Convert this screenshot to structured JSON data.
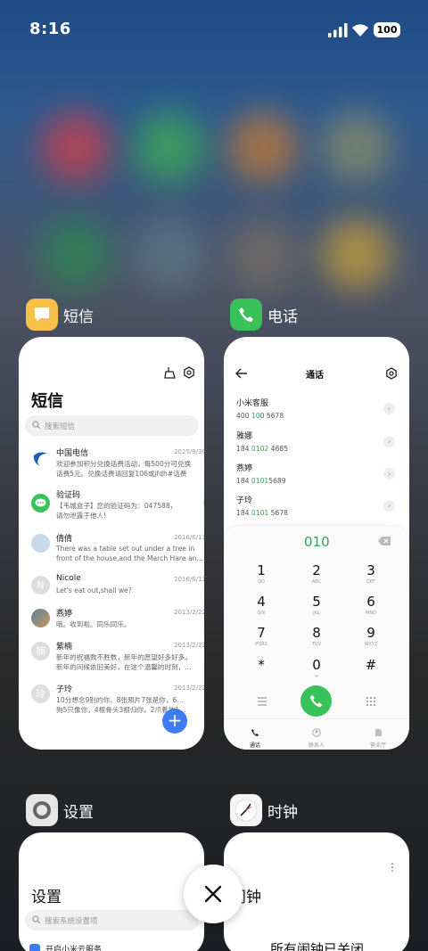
{
  "status_bar": {
    "time": "8:16",
    "battery": "100"
  },
  "apps": {
    "sms": {
      "name": "短信",
      "title": "短信",
      "search_placeholder": "搜索短信",
      "messages": [
        {
          "name": "中国电信",
          "date": "2025/9/30",
          "line1": "欢迎参加积分兑换话费活动，每500分可兑换",
          "line2": "话费5元。兑换话费请回复106或jfdh#话费"
        },
        {
          "name": "验证码",
          "date": "",
          "line1": "【韦城盒子】您的验证码为：047588，",
          "line2": "请勿泄露于他人!"
        },
        {
          "name": "倩倩",
          "date": "2016/6/13",
          "line1": "There was a table set out under a tree in",
          "line2": "front of the house,and the March Hare an..."
        },
        {
          "name": "Nicole",
          "date": "2016/6/13",
          "line1": "Let's eat out,shall we?",
          "line2": ""
        },
        {
          "name": "燕婷",
          "date": "2013/2/22",
          "line1": "哦。收到啦。同乐同乐。",
          "line2": ""
        },
        {
          "name": "紫楠",
          "date": "2013/2/22",
          "line1": "新年的祝福数不胜数，新年的愿望好多好多，",
          "line2": "新年的问候依旧美好，在这个温馨的时刻，..."
        },
        {
          "name": "子玲",
          "date": "2013/2/22",
          "line1": "10分想念9别的你，8张照片7张是你，6只小",
          "line2": "狗5只像你，4根骨头3根归你，2爪着地1定..."
        }
      ],
      "avatar_letters": {
        "nicole": "N",
        "zinan": "楠",
        "ziling": "玲"
      }
    },
    "phone": {
      "name": "电话",
      "title": "通话",
      "contacts": [
        {
          "name": "小米客服",
          "pre": "400 ",
          "hl": "10",
          "post": "0 5678"
        },
        {
          "name": "雅娜",
          "pre": "184 ",
          "hl": "0102",
          "post": " 4685"
        },
        {
          "name": "燕婷",
          "pre": "184 ",
          "hl": "0101",
          "post": "5689"
        },
        {
          "name": "子玲",
          "pre": "184 ",
          "hl": "0101",
          "post": " 5678"
        }
      ],
      "dial_input": "010",
      "keypad": [
        {
          "d": "1",
          "s": "QO"
        },
        {
          "d": "2",
          "s": "ABC"
        },
        {
          "d": "3",
          "s": "DEF"
        },
        {
          "d": "4",
          "s": "GHI"
        },
        {
          "d": "5",
          "s": "JKL"
        },
        {
          "d": "6",
          "s": "MNO"
        },
        {
          "d": "7",
          "s": "PQRS"
        },
        {
          "d": "8",
          "s": "TUV"
        },
        {
          "d": "9",
          "s": "WXYZ"
        },
        {
          "d": "*",
          "s": ""
        },
        {
          "d": "0",
          "s": "+"
        },
        {
          "d": "#",
          "s": ""
        }
      ],
      "tabs": [
        "通话",
        "联系人",
        "营业厅"
      ]
    },
    "settings": {
      "name": "设置",
      "title": "设置",
      "search_placeholder": "搜索系统设置项",
      "first_item": "开启小米云服务"
    },
    "clock": {
      "name": "时钟",
      "title": "闹钟",
      "empty_text": "所有闹钟已关闭"
    }
  },
  "colors": {
    "accent_blue": "#3d7cf5",
    "call_green": "#3ac25a",
    "dial_green": "#32a852"
  }
}
